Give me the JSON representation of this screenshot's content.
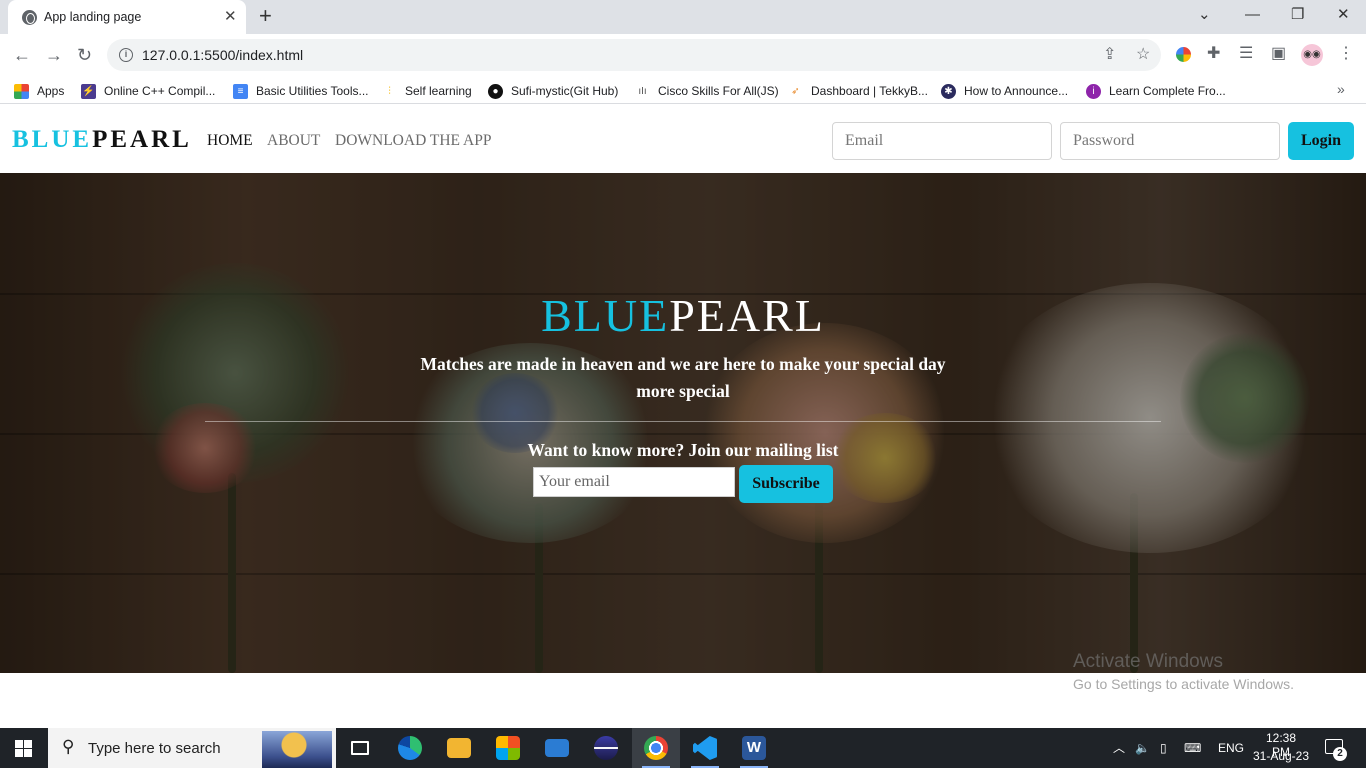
{
  "browser": {
    "tab_title": "App landing page",
    "url": "127.0.0.1:5500/index.html",
    "bookmarks": [
      {
        "label": "Apps",
        "icon": "apps-grid-icon",
        "color": "#ea4335"
      },
      {
        "label": "Online C++ Compil...",
        "icon": "compiler-icon",
        "color": "#4b3b8f"
      },
      {
        "label": "Basic Utilities Tools...",
        "icon": "docs-icon",
        "color": "#4285f4"
      },
      {
        "label": "Self learning",
        "icon": "chart-icon",
        "color": "#f4b400"
      },
      {
        "label": "Sufi-mystic(Git Hub)",
        "icon": "github-icon",
        "color": "#111111"
      },
      {
        "label": "Cisco Skills For All(JS)",
        "icon": "cisco-icon",
        "color": "#555555"
      },
      {
        "label": "Dashboard | TekkyB...",
        "icon": "tekky-icon",
        "color": "#e8892a"
      },
      {
        "label": "How to Announce...",
        "icon": "announce-icon",
        "color": "#2b2b5e"
      },
      {
        "label": "Learn Complete Fro...",
        "icon": "learn-icon",
        "color": "#8e24aa"
      }
    ]
  },
  "navbar": {
    "brand_blue": "BLUE",
    "brand_dark": "PEARL",
    "links": [
      "HOME",
      "ABOUT",
      "DOWNLOAD THE APP"
    ],
    "email_placeholder": "Email",
    "password_placeholder": "Password",
    "login_label": "Login"
  },
  "hero": {
    "title_blue": "BLUE",
    "title_white": "PEARL",
    "tagline": "Matches are made in heaven and we are here to make your special day more special",
    "mailing_heading": "Want to know more? Join our mailing list",
    "email_placeholder": "Your email",
    "subscribe_label": "Subscribe"
  },
  "watermark": {
    "line1": "Activate Windows",
    "line2": "Go to Settings to activate Windows."
  },
  "taskbar": {
    "search_placeholder": "Type here to search",
    "language": "ENG",
    "time": "12:38 PM",
    "date": "31-Aug-23",
    "notification_count": "2"
  },
  "colors": {
    "accent": "#16c1e0"
  }
}
